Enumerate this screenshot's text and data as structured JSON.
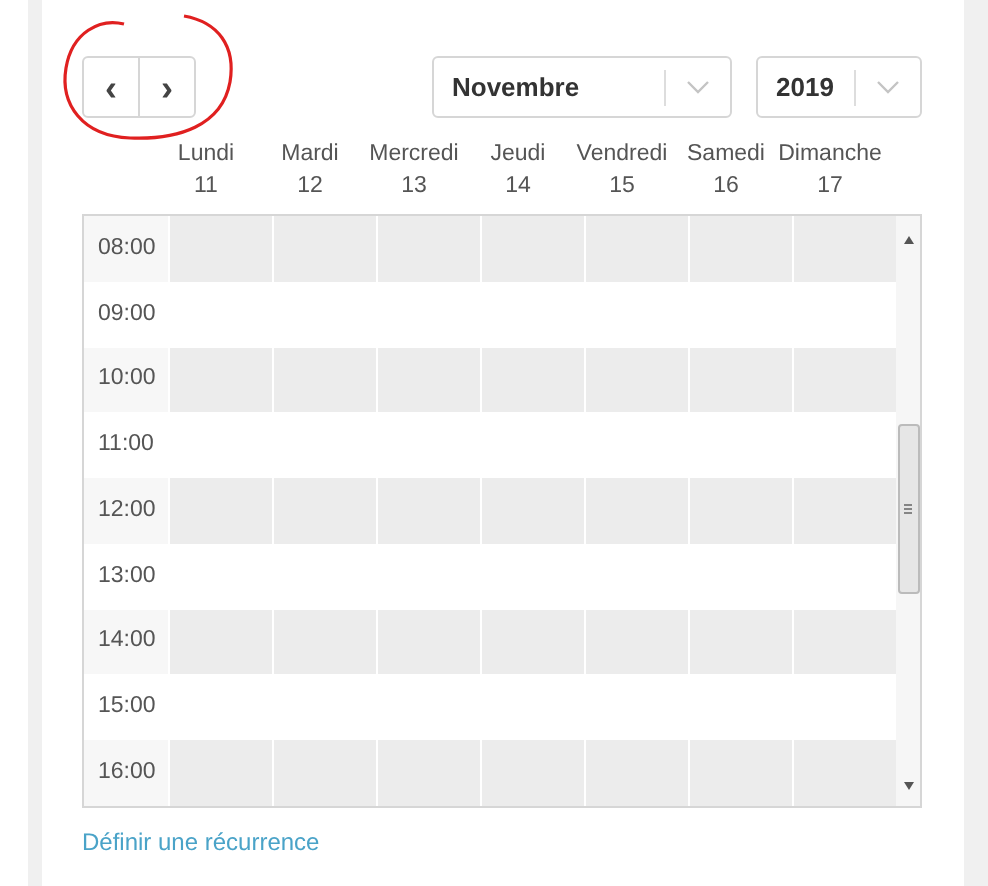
{
  "navigation": {
    "previous": "‹",
    "next": "›"
  },
  "month_select": {
    "value": "Novembre"
  },
  "year_select": {
    "value": "2019"
  },
  "days": [
    {
      "name": "Lundi",
      "date": "11"
    },
    {
      "name": "Mardi",
      "date": "12"
    },
    {
      "name": "Mercredi",
      "date": "13"
    },
    {
      "name": "Jeudi",
      "date": "14"
    },
    {
      "name": "Vendredi",
      "date": "15"
    },
    {
      "name": "Samedi",
      "date": "16"
    },
    {
      "name": "Dimanche",
      "date": "17"
    }
  ],
  "hours": [
    "08:00",
    "09:00",
    "10:00",
    "11:00",
    "12:00",
    "13:00",
    "14:00",
    "15:00",
    "16:00"
  ],
  "recurrence_link": "Définir une récurrence"
}
